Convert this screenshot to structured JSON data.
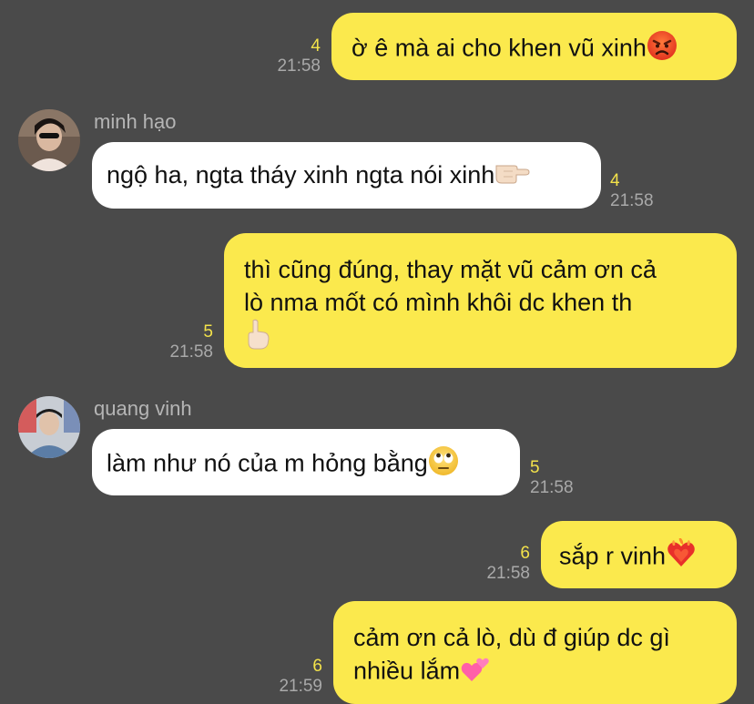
{
  "messages": [
    {
      "id": "m1",
      "direction": "out",
      "text": "ờ ê mà ai cho khen vũ xinh",
      "emoji": "angry-face-emoji",
      "read_count": "4",
      "time": "21:58"
    },
    {
      "id": "m2",
      "direction": "in",
      "sender": "minh hạo",
      "text": "ngộ ha, ngta tháy xinh ngta nói xinh",
      "emoji": "pointing-hand-emoji",
      "read_count": "4",
      "time": "21:58"
    },
    {
      "id": "m3",
      "direction": "out",
      "line1": "thì cũng đúng, thay mặt vũ cảm ơn cả",
      "line2": "lò nma mốt có mình khôi dc khen th",
      "emoji": "pointing-up-hand-emoji",
      "read_count": "5",
      "time": "21:58"
    },
    {
      "id": "m4",
      "direction": "in",
      "sender": "quang vinh",
      "text": "làm như nó của m hỏng bằng",
      "emoji": "eye-roll-emoji",
      "read_count": "5",
      "time": "21:58"
    },
    {
      "id": "m5",
      "direction": "out",
      "text": "sắp r vinh",
      "emoji": "heart-on-fire-emoji",
      "read_count": "6",
      "time": "21:58"
    },
    {
      "id": "m6",
      "direction": "out",
      "line1": "cảm ơn cả lò, dù đ giúp dc gì",
      "line2": "nhiều lắm",
      "emoji": "two-hearts-emoji",
      "read_count": "6",
      "time": "21:59"
    }
  ],
  "colors": {
    "background": "#4a4a4a",
    "outgoing_bubble": "#fbe94d",
    "incoming_bubble": "#ffffff",
    "read_count": "#f3e24a",
    "timestamp": "#a9a9a9",
    "sender_name": "#b5b5b5"
  }
}
